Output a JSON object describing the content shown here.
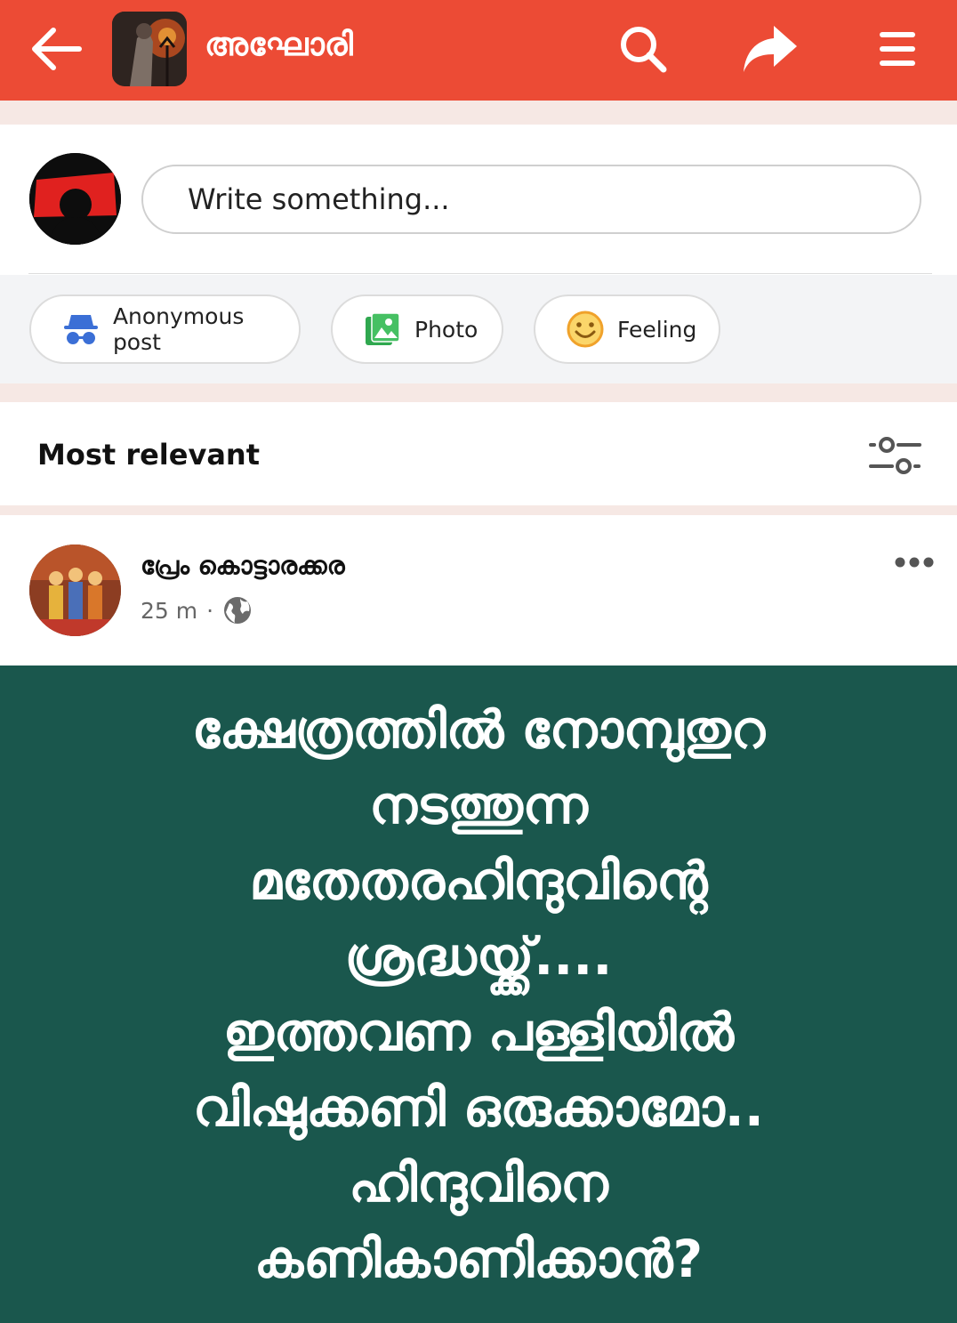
{
  "header": {
    "title": "അഘോരി",
    "background_color": "#ec4b35",
    "icons": [
      "back-arrow-icon",
      "search-icon",
      "share-icon",
      "menu-icon"
    ]
  },
  "composer": {
    "placeholder": "Write something...",
    "actions": [
      {
        "label": "Anonymous post",
        "icon": "incognito-icon"
      },
      {
        "label": "Photo",
        "icon": "photo-icon"
      },
      {
        "label": "Feeling",
        "icon": "smiley-icon"
      }
    ]
  },
  "sort": {
    "label": "Most relevant",
    "icon": "filter-sliders-icon"
  },
  "post": {
    "author": "പ്രേം കൊട്ടാരക്കര",
    "time": "25 m",
    "separator": "·",
    "privacy_icon": "globe-icon",
    "text": "ക്ഷേത്രത്തിൽ നോമ്പുതുറ\nനടത്തുന്ന\nമതേതരഹിന്ദുവിന്റെ\nശ്രദ്ധയ്ക്ക്....\nഇത്തവണ പള്ളിയിൽ\nവിഷുക്കണി ഒരുക്കാമോ..\nഹിന്ദുവിനെ\nകണികാണിക്കാൻ?",
    "background_color": "#1a574d"
  }
}
